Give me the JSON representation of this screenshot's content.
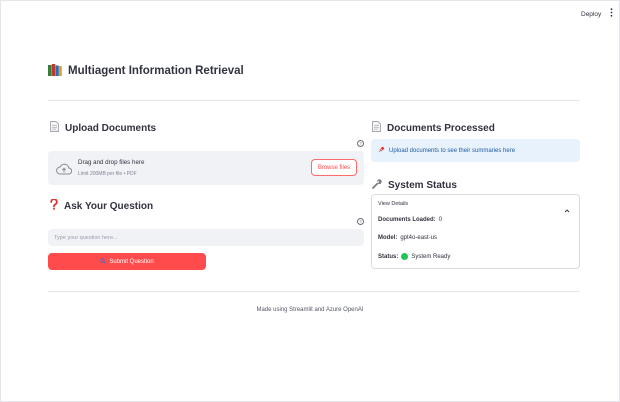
{
  "topbar": {
    "deploy_label": "Deploy",
    "menu_icon": "kebab-menu-icon"
  },
  "app": {
    "title": "Multiagent Information Retrieval",
    "title_icon": "books-icon"
  },
  "upload": {
    "heading": "Upload Documents",
    "heading_icon": "page-icon",
    "dropzone_text": "Drag and drop files here",
    "limit_text": "Limit 200MB per file • PDF",
    "browse_label": "Browse files",
    "cloud_icon": "cloud-upload-icon"
  },
  "question": {
    "heading": "Ask Your Question",
    "heading_icon": "question-mark-icon",
    "placeholder": "Type your question here...",
    "submit_label": "Submit Question",
    "submit_icon": "search-icon"
  },
  "processed": {
    "heading": "Documents Processed",
    "heading_icon": "page-icon",
    "info_icon": "pushpin-icon",
    "info_text": "Upload documents to see their summaries here"
  },
  "status": {
    "heading": "System Status",
    "heading_icon": "wrench-icon",
    "expander_label": "View Details",
    "docs_loaded_label": "Documents Loaded:",
    "docs_loaded_value": "0",
    "model_label": "Model:",
    "model_value": "gpt4o-east-us",
    "status_label": "Status:",
    "status_value": "System Ready",
    "status_color": "#21c354"
  },
  "footer": {
    "text": "Made using Streamlit and Azure OpenAI"
  },
  "colors": {
    "primary": "#ff4b4b",
    "info_bg": "#e8f2fc",
    "info_text": "#1e5aa0",
    "input_bg": "#f0f2f6"
  }
}
